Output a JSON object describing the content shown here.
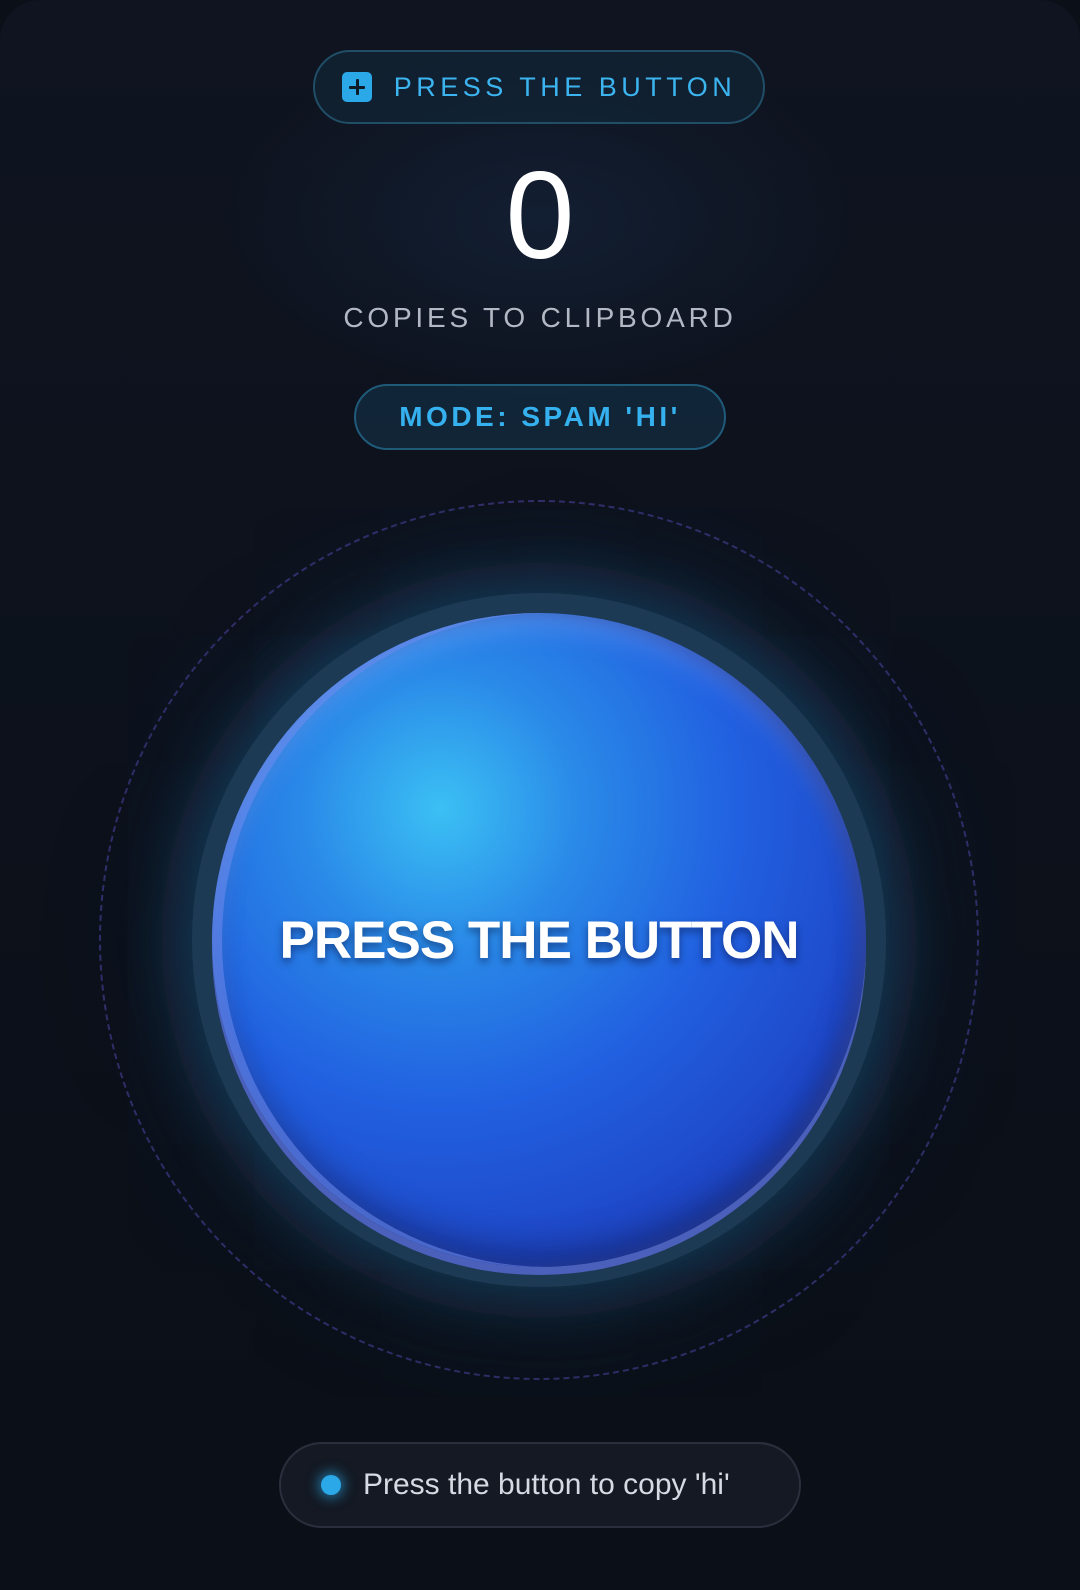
{
  "header": {
    "pill_label": "PRESS THE BUTTON",
    "pill_icon": "plus-square-icon"
  },
  "counter": {
    "value": "0",
    "caption": "COPIES TO CLIPBOARD"
  },
  "mode": {
    "label": "MODE: SPAM 'HI'"
  },
  "main_button": {
    "label": "PRESS THE BUTTON"
  },
  "status": {
    "text": "Press the button to copy 'hi'"
  },
  "colors": {
    "accent": "#2aa8e8",
    "button_blue": "#2160e0",
    "background": "#0b0f17"
  }
}
